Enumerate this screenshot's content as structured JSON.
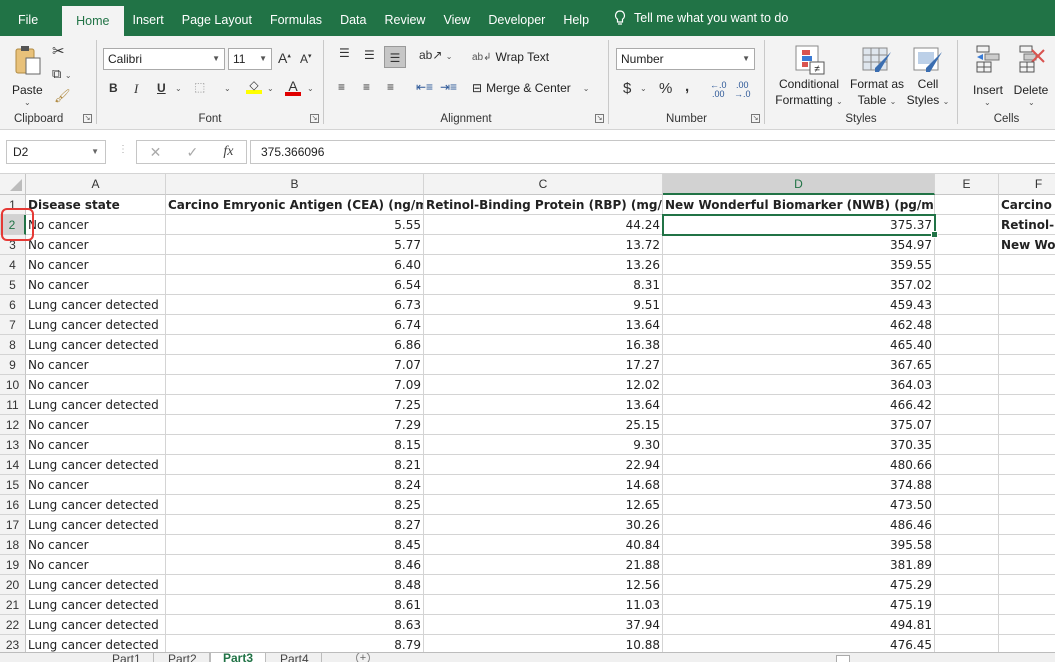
{
  "ribbon_tabs": [
    {
      "label": "File"
    },
    {
      "label": "Home"
    },
    {
      "label": "Insert"
    },
    {
      "label": "Page Layout"
    },
    {
      "label": "Formulas"
    },
    {
      "label": "Data"
    },
    {
      "label": "Review"
    },
    {
      "label": "View"
    },
    {
      "label": "Developer"
    },
    {
      "label": "Help"
    }
  ],
  "tell_me": "Tell me what you want to do",
  "clipboard": {
    "paste": "Paste",
    "group": "Clipboard"
  },
  "font": {
    "name": "Calibri",
    "size": "11",
    "group": "Font",
    "bold": "B",
    "italic": "I",
    "underline": "U"
  },
  "alignment": {
    "wrap_text": "Wrap Text",
    "merge_center": "Merge & Center",
    "group": "Alignment"
  },
  "number": {
    "format": "Number",
    "currency": "$",
    "percent": "%",
    "comma": ",",
    "group": "Number"
  },
  "styles": {
    "conditional": "Conditional",
    "formatting": "Formatting",
    "format_as": "Format as",
    "table": "Table",
    "cell": "Cell",
    "cell_styles": "Styles",
    "group": "Styles"
  },
  "cells": {
    "insert": "Insert",
    "delete": "Delete",
    "group": "Cells"
  },
  "formula_bar": {
    "name_box": "D2",
    "fx": "fx",
    "value": "375.366096"
  },
  "columns": [
    "A",
    "B",
    "C",
    "D",
    "E",
    "F"
  ],
  "headers": [
    "Disease state",
    "Carcino Emryonic Antigen (CEA) (ng/ml)",
    "Retinol-Binding Protein (RBP) (mg/L)",
    "New Wonderful Biomarker (NWB) (pg/ml)",
    "",
    "Carcino E"
  ],
  "side_labels": [
    "Retinol-E",
    "New Wo"
  ],
  "rows": [
    {
      "n": "2",
      "state": "No cancer",
      "cea": "5.55",
      "rbp": "44.24",
      "nwb": "375.37"
    },
    {
      "n": "3",
      "state": "No cancer",
      "cea": "5.77",
      "rbp": "13.72",
      "nwb": "354.97"
    },
    {
      "n": "4",
      "state": "No cancer",
      "cea": "6.40",
      "rbp": "13.26",
      "nwb": "359.55"
    },
    {
      "n": "5",
      "state": "No cancer",
      "cea": "6.54",
      "rbp": "8.31",
      "nwb": "357.02"
    },
    {
      "n": "6",
      "state": "Lung cancer detected",
      "cea": "6.73",
      "rbp": "9.51",
      "nwb": "459.43"
    },
    {
      "n": "7",
      "state": "Lung cancer detected",
      "cea": "6.74",
      "rbp": "13.64",
      "nwb": "462.48"
    },
    {
      "n": "8",
      "state": "Lung cancer detected",
      "cea": "6.86",
      "rbp": "16.38",
      "nwb": "465.40"
    },
    {
      "n": "9",
      "state": "No cancer",
      "cea": "7.07",
      "rbp": "17.27",
      "nwb": "367.65"
    },
    {
      "n": "10",
      "state": "No cancer",
      "cea": "7.09",
      "rbp": "12.02",
      "nwb": "364.03"
    },
    {
      "n": "11",
      "state": "Lung cancer detected",
      "cea": "7.25",
      "rbp": "13.64",
      "nwb": "466.42"
    },
    {
      "n": "12",
      "state": "No cancer",
      "cea": "7.29",
      "rbp": "25.15",
      "nwb": "375.07"
    },
    {
      "n": "13",
      "state": "No cancer",
      "cea": "8.15",
      "rbp": "9.30",
      "nwb": "370.35"
    },
    {
      "n": "14",
      "state": "Lung cancer detected",
      "cea": "8.21",
      "rbp": "22.94",
      "nwb": "480.66"
    },
    {
      "n": "15",
      "state": "No cancer",
      "cea": "8.24",
      "rbp": "14.68",
      "nwb": "374.88"
    },
    {
      "n": "16",
      "state": "Lung cancer detected",
      "cea": "8.25",
      "rbp": "12.65",
      "nwb": "473.50"
    },
    {
      "n": "17",
      "state": "Lung cancer detected",
      "cea": "8.27",
      "rbp": "30.26",
      "nwb": "486.46"
    },
    {
      "n": "18",
      "state": "No cancer",
      "cea": "8.45",
      "rbp": "40.84",
      "nwb": "395.58"
    },
    {
      "n": "19",
      "state": "No cancer",
      "cea": "8.46",
      "rbp": "21.88",
      "nwb": "381.89"
    },
    {
      "n": "20",
      "state": "Lung cancer detected",
      "cea": "8.48",
      "rbp": "12.56",
      "nwb": "475.29"
    },
    {
      "n": "21",
      "state": "Lung cancer detected",
      "cea": "8.61",
      "rbp": "11.03",
      "nwb": "475.19"
    },
    {
      "n": "22",
      "state": "Lung cancer detected",
      "cea": "8.63",
      "rbp": "37.94",
      "nwb": "494.81"
    },
    {
      "n": "23",
      "state": "Lung cancer detected",
      "cea": "8.79",
      "rbp": "10.88",
      "nwb": "476.45"
    }
  ],
  "sheet_tabs": [
    "Part1",
    "Part2",
    "Part3",
    "Part4"
  ],
  "active_sheet": "Part3",
  "colors": {
    "brand": "#217346",
    "highlight_mark": "#e53935"
  }
}
